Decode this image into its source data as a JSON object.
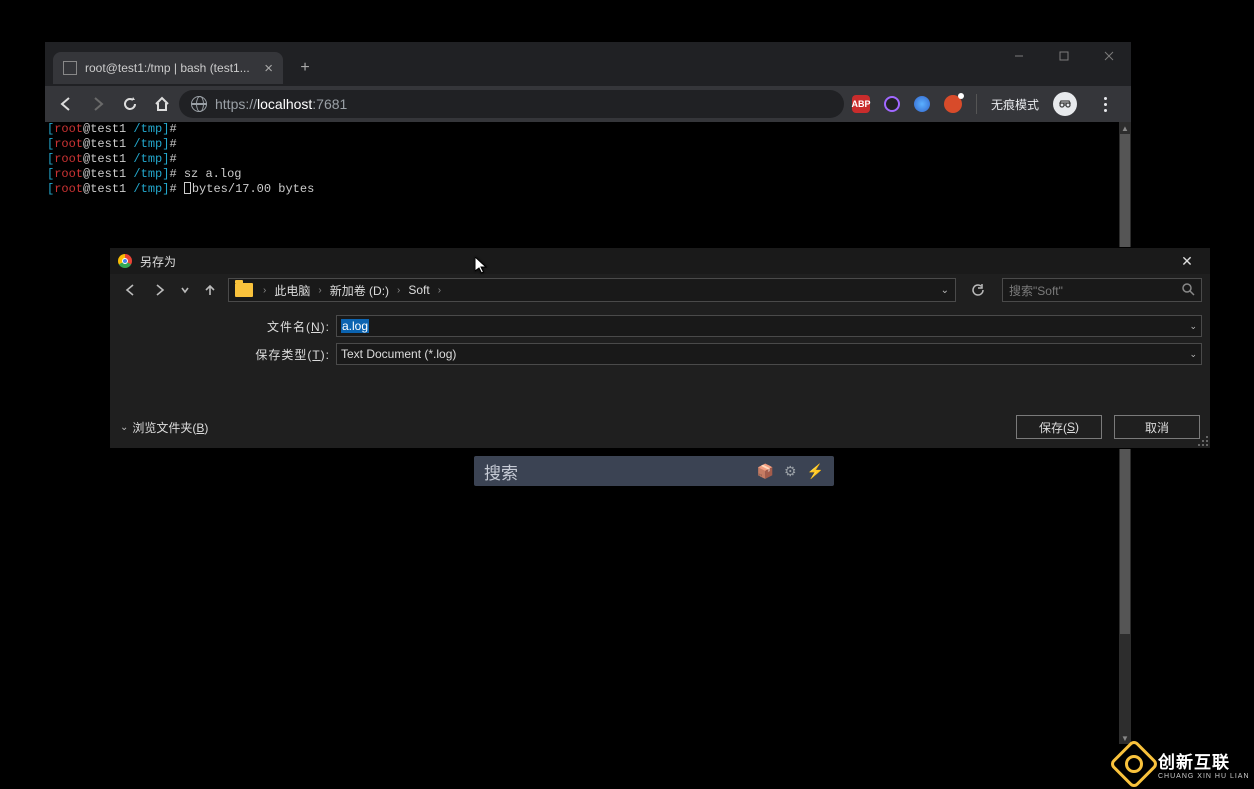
{
  "window": {
    "tab_title": "root@test1:/tmp | bash (test1...",
    "min_tooltip": "Minimize",
    "max_tooltip": "Maximize",
    "close_tooltip": "Close"
  },
  "toolbar": {
    "url_proto": "https://",
    "url_host": "localhost",
    "url_port": ":7681",
    "new_tab": "+",
    "incognito_label": "无痕模式",
    "ext_abp": "ABP"
  },
  "terminal": {
    "lines": [
      {
        "user": "root",
        "host": "@test1",
        "path": " /tmp",
        "cmd": ""
      },
      {
        "user": "root",
        "host": "@test1",
        "path": " /tmp",
        "cmd": ""
      },
      {
        "user": "root",
        "host": "@test1",
        "path": " /tmp",
        "cmd": ""
      },
      {
        "user": "root",
        "host": "@test1",
        "path": " /tmp",
        "cmd": " sz a.log"
      }
    ],
    "last": {
      "user": "root",
      "host": "@test1",
      "path": " /tmp",
      "tail": "bytes/17.00 bytes"
    }
  },
  "dialog": {
    "title": "另存为",
    "breadcrumbs": [
      "此电脑",
      "新加卷 (D:)",
      "Soft"
    ],
    "search_placeholder": "搜索\"Soft\"",
    "filename_label_pre": "文件名(",
    "filename_label_sc": "N",
    "filename_label_post": "):",
    "filename_value": "a.log",
    "filetype_label_pre": "保存类型(",
    "filetype_label_sc": "T",
    "filetype_label_post": "):",
    "filetype_value": "Text Document (*.log)",
    "browse_folders_pre": "浏览文件夹(",
    "browse_folders_sc": "B",
    "browse_folders_post": ")",
    "save_btn_pre": "保存(",
    "save_btn_sc": "S",
    "save_btn_post": ")",
    "cancel_btn": "取消"
  },
  "float_search": {
    "placeholder": "搜索",
    "icon_box": "📦",
    "icon_gear": "⚙",
    "icon_bolt": "⚡"
  },
  "watermark": {
    "cn": "创新互联",
    "en": "CHUANG XIN HU LIAN"
  }
}
